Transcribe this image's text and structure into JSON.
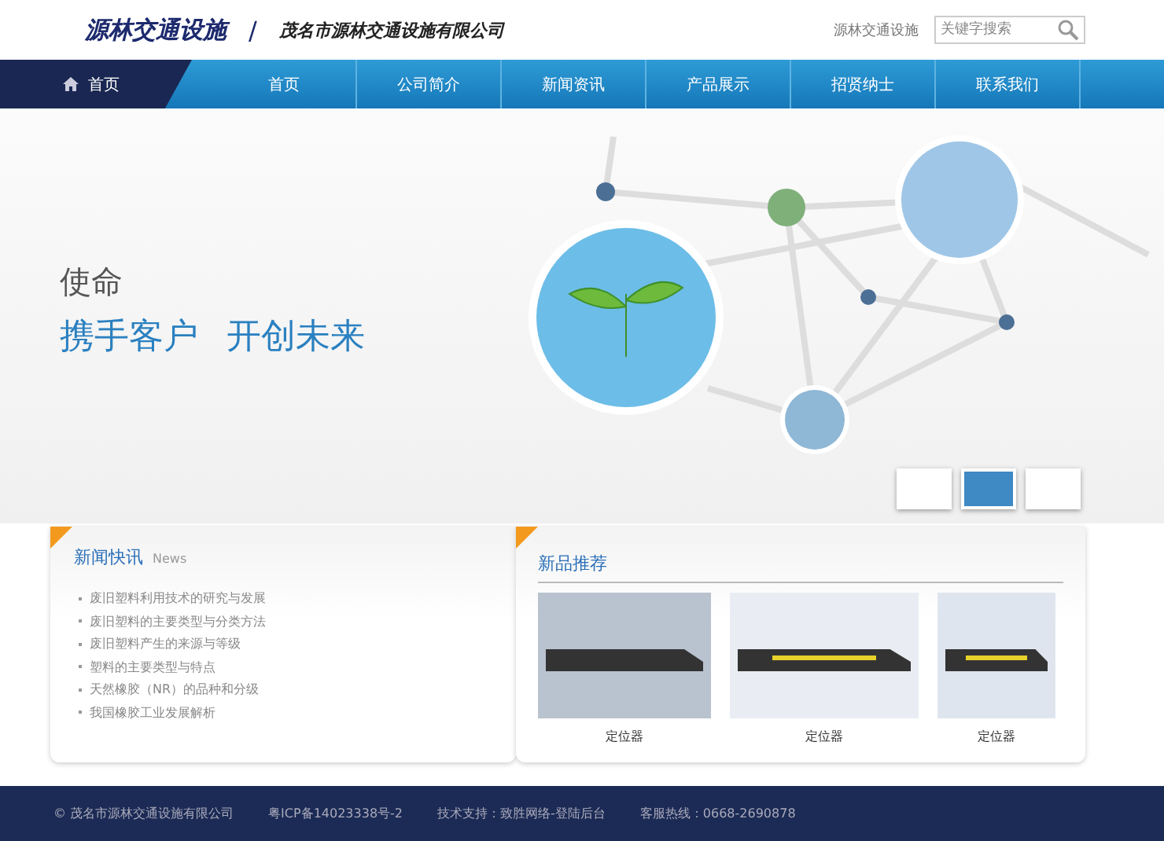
{
  "header": {
    "brand": "源林交通设施",
    "separator": "/",
    "company": "茂名市源林交通设施有限公司",
    "site_label": "源林交通设施",
    "search": {
      "placeholder": "关键字搜索"
    }
  },
  "nav": {
    "home": {
      "label": "首页"
    },
    "items": [
      {
        "label": "首页",
        "selected": false
      },
      {
        "label": "公司简介",
        "selected": false
      },
      {
        "label": "新闻资讯",
        "selected": false
      },
      {
        "label": "产品展示",
        "selected": false
      },
      {
        "label": "招贤纳士",
        "selected": false
      },
      {
        "label": "联系我们",
        "selected": false
      }
    ]
  },
  "banner": {
    "title": "使命",
    "slogan": [
      "携手客户",
      "开创未来"
    ],
    "slides": [
      {
        "selected": false
      },
      {
        "selected": true
      },
      {
        "selected": false
      }
    ]
  },
  "news": {
    "title": "新闻快讯",
    "subtitle": "News",
    "items": [
      "废旧塑料利用技术的研究与发展",
      "废旧塑料的主要类型与分类方法",
      "废旧塑料产生的来源与等级",
      "塑料的主要类型与特点",
      "天然橡胶（NR）的品种和分级",
      "我国橡胶工业发展解析"
    ]
  },
  "products": {
    "title": "新品推荐",
    "items": [
      {
        "caption": "定位器"
      },
      {
        "caption": "定位器"
      },
      {
        "caption": "定位器"
      }
    ]
  },
  "footer": [
    "©  茂名市源林交通设施有限公司",
    "粤ICP备14023338号-2",
    "技术支持：致胜网络-登陆后台",
    "客服热线：0668-2690878"
  ]
}
